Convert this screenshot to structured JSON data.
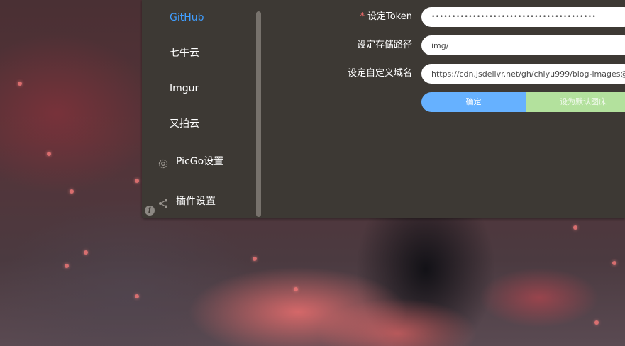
{
  "sidebar": {
    "items": [
      {
        "label": "GitHub",
        "active": true
      },
      {
        "label": "七牛云"
      },
      {
        "label": "Imgur"
      },
      {
        "label": "又拍云"
      },
      {
        "label": "PicGo设置",
        "icon": "gear-icon"
      },
      {
        "label": "插件设置",
        "icon": "share-icon"
      }
    ],
    "info_icon": "i"
  },
  "form": {
    "token": {
      "required_mark": "*",
      "label": "设定Token",
      "value": "••••••••••••••••••••••••••••••••••••••••"
    },
    "path": {
      "label": "设定存储路径",
      "value": "img/"
    },
    "domain": {
      "label": "设定自定义域名",
      "value": "https://cdn.jsdelivr.net/gh/chiyu999/blog-images@"
    },
    "confirm_button": "确定",
    "default_button": "设为默认图床"
  },
  "colors": {
    "accent": "#409eff",
    "window_bg": "#3d3934",
    "confirm": "#66b1ff",
    "default_disabled": "#b3e19d",
    "required": "#f56c6c"
  }
}
